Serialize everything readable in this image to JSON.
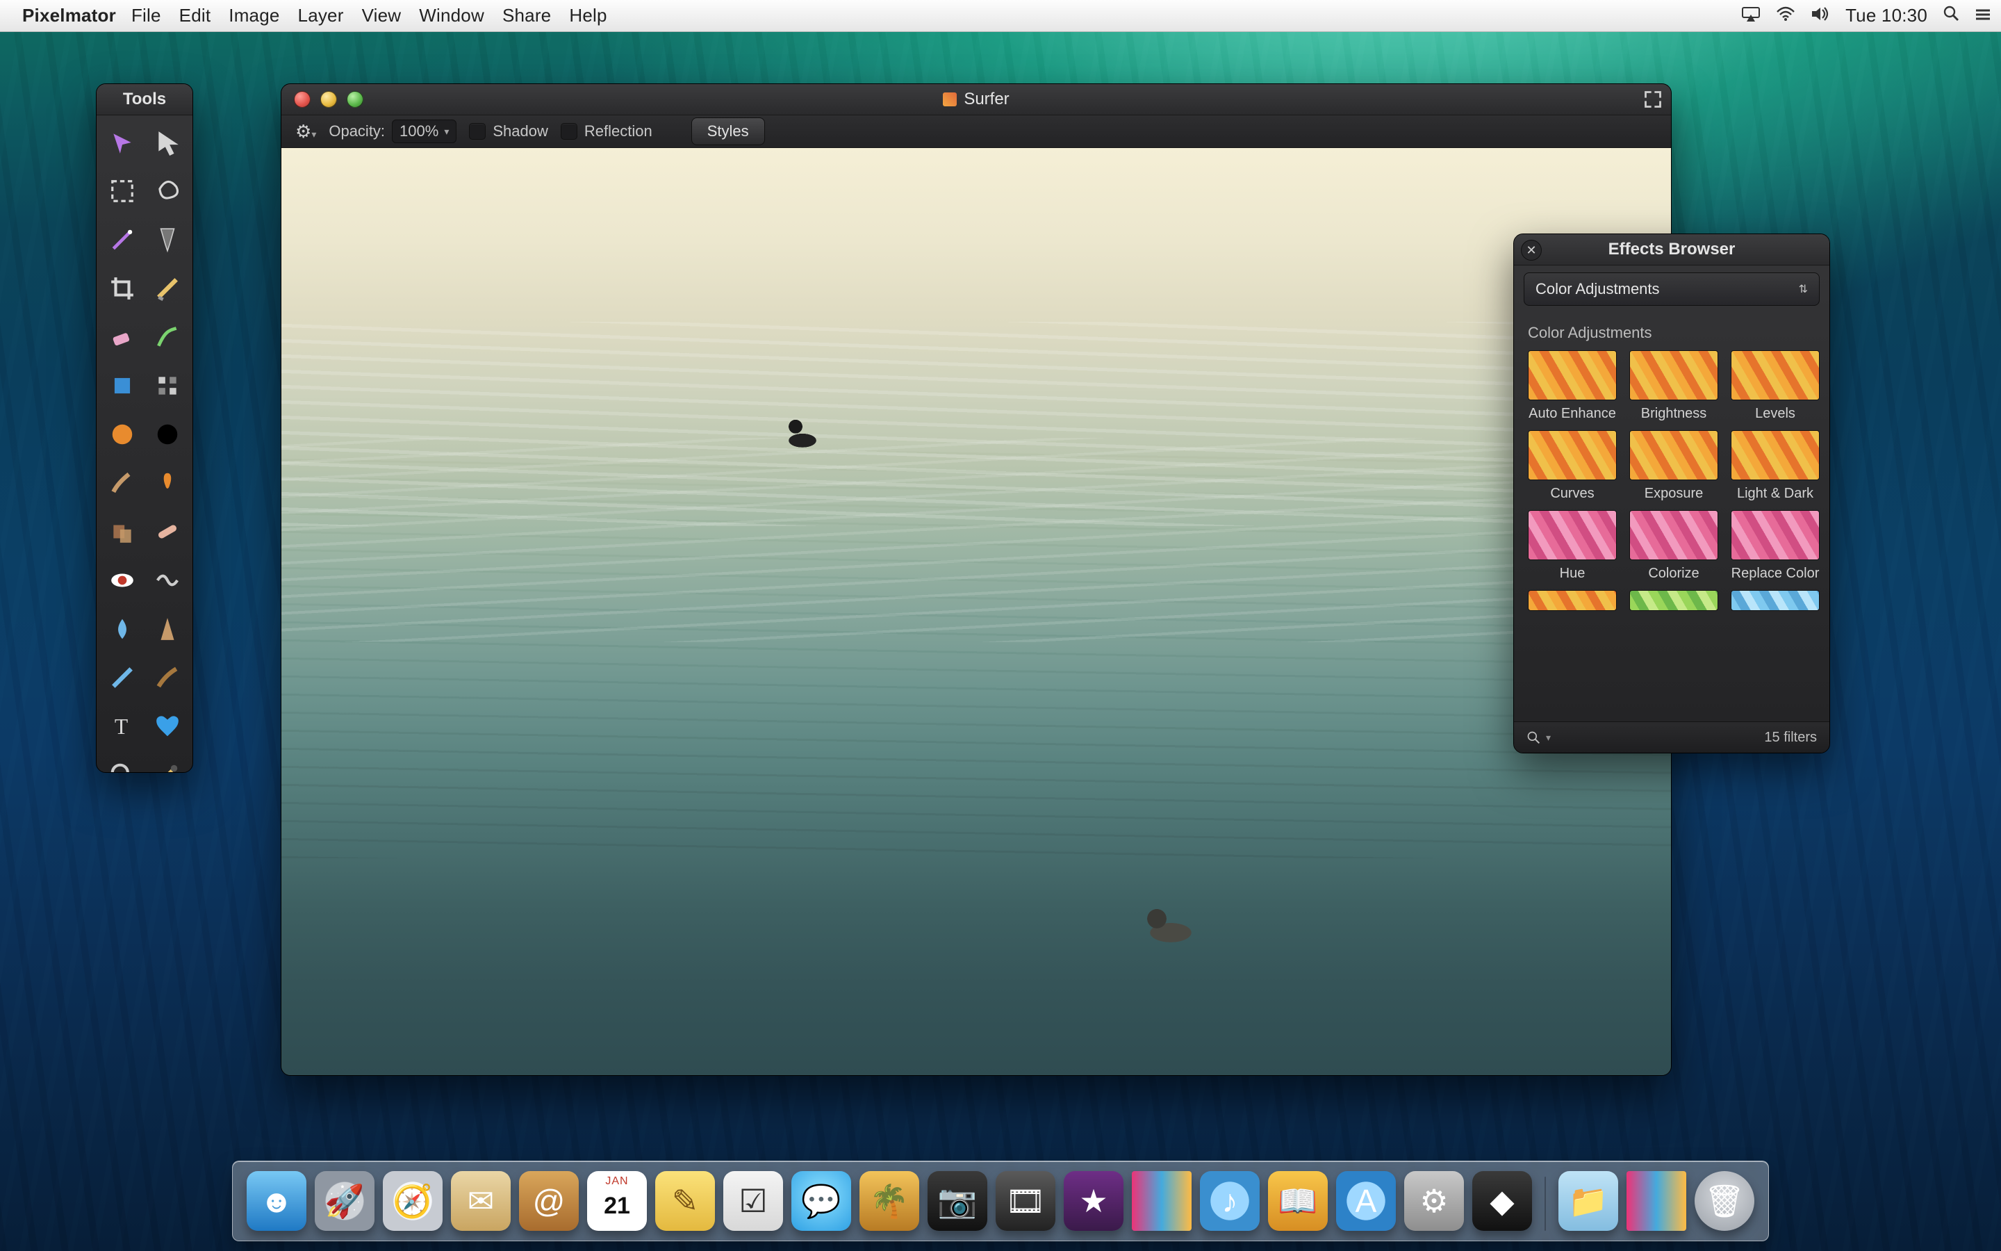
{
  "menubar": {
    "app": "Pixelmator",
    "items": [
      "File",
      "Edit",
      "Image",
      "Layer",
      "View",
      "Window",
      "Share",
      "Help"
    ],
    "clock": "Tue 10:30"
  },
  "tools_panel": {
    "title": "Tools",
    "tools": [
      "move-tool",
      "arrow-tool",
      "marquee-tool",
      "lasso-tool",
      "magic-wand-tool",
      "pen-tool",
      "crop-tool",
      "slice-tool",
      "eraser-tool",
      "paint-tool",
      "shape-tool",
      "pixel-tool",
      "gradient-tool",
      "color-picker-tool",
      "brush-tool",
      "sponge-tool",
      "clone-tool",
      "heal-tool",
      "red-eye-tool",
      "warp-tool",
      "blur-tool",
      "sharpen-tool",
      "smudge-tool",
      "burn-tool",
      "type-tool",
      "favorite-tool",
      "zoom-tool",
      "eyedropper-tool"
    ]
  },
  "document": {
    "title": "Surfer",
    "toolbar": {
      "opacity_label": "Opacity:",
      "opacity_value": "100%",
      "shadow_label": "Shadow",
      "reflection_label": "Reflection",
      "styles_label": "Styles"
    }
  },
  "effects": {
    "title": "Effects Browser",
    "category": "Color Adjustments",
    "section": "Color Adjustments",
    "items_row1": [
      {
        "name": "Auto Enhance",
        "sw": "sw-orange"
      },
      {
        "name": "Brightness",
        "sw": "sw-orange"
      },
      {
        "name": "Levels",
        "sw": "sw-orange"
      }
    ],
    "items_row2": [
      {
        "name": "Curves",
        "sw": "sw-orange"
      },
      {
        "name": "Exposure",
        "sw": "sw-orange"
      },
      {
        "name": "Light & Dark",
        "sw": "sw-orange"
      }
    ],
    "items_row3": [
      {
        "name": "Hue",
        "sw": "sw-pink"
      },
      {
        "name": "Colorize",
        "sw": "sw-pink"
      },
      {
        "name": "Replace Color",
        "sw": "sw-pink"
      }
    ],
    "items_row4": [
      {
        "name": "",
        "sw": "sw-orange"
      },
      {
        "name": "",
        "sw": "sw-green"
      },
      {
        "name": "",
        "sw": "sw-blue"
      }
    ],
    "count_label": "15 filters"
  },
  "dock": {
    "items": [
      {
        "n": "finder",
        "cls": "di-finder",
        "g": "☻"
      },
      {
        "n": "launchpad",
        "cls": "di-launch",
        "g": "🚀"
      },
      {
        "n": "safari",
        "cls": "di-safari",
        "g": "🧭"
      },
      {
        "n": "mail",
        "cls": "di-mail",
        "g": "✉"
      },
      {
        "n": "contacts",
        "cls": "di-contacts",
        "g": "@"
      },
      {
        "n": "calendar",
        "cls": "di-cal",
        "g": ""
      },
      {
        "n": "notes",
        "cls": "di-notes",
        "g": "✎"
      },
      {
        "n": "reminders",
        "cls": "di-remind",
        "g": "☑"
      },
      {
        "n": "messages",
        "cls": "di-msg",
        "g": "💬"
      },
      {
        "n": "iphoto",
        "cls": "di-iphoto",
        "g": "🌴"
      },
      {
        "n": "facetime",
        "cls": "di-ft",
        "g": "📷"
      },
      {
        "n": "photobooth",
        "cls": "di-pb",
        "g": "🎞"
      },
      {
        "n": "imovie",
        "cls": "di-imovie",
        "g": "★"
      },
      {
        "n": "maps",
        "cls": "di-photo",
        "g": ""
      },
      {
        "n": "itunes",
        "cls": "di-itunes",
        "g": "♪"
      },
      {
        "n": "ibooks",
        "cls": "di-ibooks",
        "g": "📖"
      },
      {
        "n": "appstore",
        "cls": "di-store",
        "g": "A"
      },
      {
        "n": "systemprefs",
        "cls": "di-sys",
        "g": "⚙"
      },
      {
        "n": "pixelmator",
        "cls": "di-px",
        "g": "◆"
      }
    ],
    "right": [
      {
        "n": "downloads",
        "cls": "di-folder",
        "g": "📁"
      },
      {
        "n": "stack",
        "cls": "di-photo",
        "g": ""
      },
      {
        "n": "trash",
        "cls": "di-trash",
        "g": "🗑"
      }
    ],
    "cal_day": "21"
  }
}
